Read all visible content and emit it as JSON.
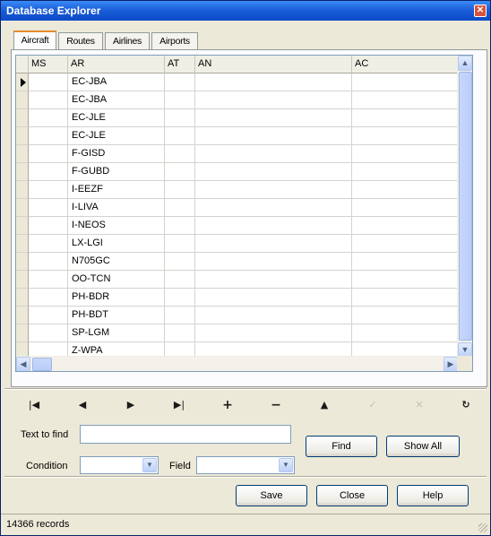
{
  "window": {
    "title": "Database Explorer",
    "close_glyph": "✕"
  },
  "tabs": [
    {
      "label": "Aircraft",
      "active": true
    },
    {
      "label": "Routes",
      "active": false
    },
    {
      "label": "Airlines",
      "active": false
    },
    {
      "label": "Airports",
      "active": false
    }
  ],
  "grid": {
    "columns": [
      "MS",
      "AR",
      "AT",
      "AN",
      "AC"
    ],
    "rows": [
      {
        "ms": "",
        "ar": "EC-JBA",
        "at": "",
        "an": "",
        "ac": ""
      },
      {
        "ms": "",
        "ar": "EC-JBA",
        "at": "",
        "an": "",
        "ac": ""
      },
      {
        "ms": "",
        "ar": "EC-JLE",
        "at": "",
        "an": "",
        "ac": ""
      },
      {
        "ms": "",
        "ar": "EC-JLE",
        "at": "",
        "an": "",
        "ac": ""
      },
      {
        "ms": "",
        "ar": "F-GISD",
        "at": "",
        "an": "",
        "ac": ""
      },
      {
        "ms": "",
        "ar": "F-GUBD",
        "at": "",
        "an": "",
        "ac": ""
      },
      {
        "ms": "",
        "ar": "I-EEZF",
        "at": "",
        "an": "",
        "ac": ""
      },
      {
        "ms": "",
        "ar": "I-LIVA",
        "at": "",
        "an": "",
        "ac": ""
      },
      {
        "ms": "",
        "ar": "I-NEOS",
        "at": "",
        "an": "",
        "ac": ""
      },
      {
        "ms": "",
        "ar": "LX-LGI",
        "at": "",
        "an": "",
        "ac": ""
      },
      {
        "ms": "",
        "ar": "N705GC",
        "at": "",
        "an": "",
        "ac": ""
      },
      {
        "ms": "",
        "ar": "OO-TCN",
        "at": "",
        "an": "",
        "ac": ""
      },
      {
        "ms": "",
        "ar": "PH-BDR",
        "at": "",
        "an": "",
        "ac": ""
      },
      {
        "ms": "",
        "ar": "PH-BDT",
        "at": "",
        "an": "",
        "ac": ""
      },
      {
        "ms": "",
        "ar": "SP-LGM",
        "at": "",
        "an": "",
        "ac": ""
      },
      {
        "ms": "",
        "ar": "Z-WPA",
        "at": "",
        "an": "",
        "ac": ""
      }
    ],
    "current_row_marker": "▶"
  },
  "navigator": [
    {
      "name": "first-record-button",
      "glyph": "|◀",
      "enabled": true
    },
    {
      "name": "prior-record-button",
      "glyph": "◀",
      "enabled": true
    },
    {
      "name": "next-record-button",
      "glyph": "▶",
      "enabled": true
    },
    {
      "name": "last-record-button",
      "glyph": "▶|",
      "enabled": true
    },
    {
      "name": "insert-record-button",
      "glyph": "+",
      "enabled": true
    },
    {
      "name": "delete-record-button",
      "glyph": "−",
      "enabled": true
    },
    {
      "name": "edit-record-button",
      "glyph": "▲",
      "enabled": true
    },
    {
      "name": "post-edit-button",
      "glyph": "✓",
      "enabled": false
    },
    {
      "name": "cancel-edit-button",
      "glyph": "✕",
      "enabled": false
    },
    {
      "name": "refresh-data-button",
      "glyph": "↻",
      "enabled": true
    }
  ],
  "search": {
    "text_to_find_label": "Text to find",
    "text_to_find_value": "",
    "condition_label": "Condition",
    "condition_value": "",
    "field_label": "Field",
    "field_value": "",
    "find_label": "Find",
    "show_all_label": "Show All"
  },
  "actions": {
    "save_label": "Save",
    "close_label": "Close",
    "help_label": "Help"
  },
  "status": {
    "records_text": "14366 records"
  }
}
